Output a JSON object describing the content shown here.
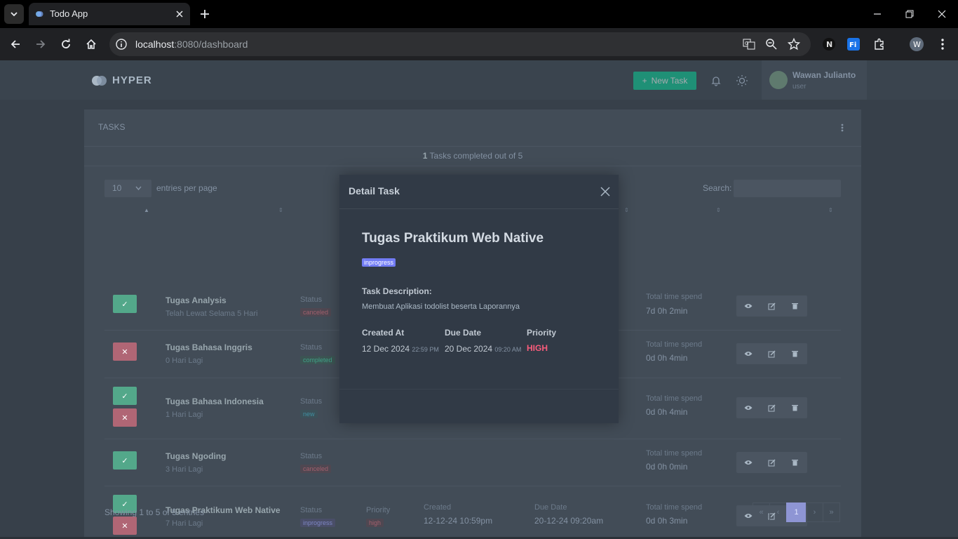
{
  "browser": {
    "tab_title": "Todo App",
    "url_host": "localhost",
    "url_rest": ":8080/dashboard",
    "extensions": [
      "N",
      "Fi",
      "W"
    ]
  },
  "header": {
    "brand": "HYPER",
    "new_task": "New Task",
    "user_name": "Wawan Julianto",
    "user_role": "user"
  },
  "card": {
    "title": "TASKS",
    "completed_count": "1",
    "completed_text": "Tasks completed out of 5",
    "entries_value": "10",
    "entries_label": "entries per page",
    "search_label": "Search:"
  },
  "labels": {
    "status": "Status",
    "priority": "Priority",
    "created": "Created",
    "due_date": "Due Date",
    "total_time": "Total time spend"
  },
  "tasks": [
    {
      "title": "Tugas Analysis",
      "sub": "Telah Lewat Selama 5 Hari",
      "status": "canceled",
      "time": "7d 0h 2min"
    },
    {
      "title": "Tugas Bahasa Inggris",
      "sub": "0 Hari Lagi",
      "status": "completed",
      "time": "0d 0h 4min"
    },
    {
      "title": "Tugas Bahasa Indonesia",
      "sub": "1 Hari Lagi",
      "status": "new",
      "time": "0d 0h 4min"
    },
    {
      "title": "Tugas Ngoding",
      "sub": "3 Hari Lagi",
      "status": "canceled",
      "time": "0d 0h 0min"
    },
    {
      "title": "Tugas Praktikum Web Native",
      "sub": "7 Hari Lagi",
      "status": "inprogress",
      "priority": "high",
      "created": "12-12-24 10:59pm",
      "due": "20-12-24 09:20am",
      "time": "0d 0h 3min"
    }
  ],
  "footer": {
    "showing": "Showing 1 to 5 of 5 entries",
    "pages": [
      "«",
      "‹",
      "1",
      "›",
      "»"
    ]
  },
  "modal": {
    "title": "Detail Task",
    "task_title": "Tugas Praktikum Web Native",
    "status": "inprogress",
    "desc_label": "Task Description:",
    "desc": "Membuat Aplikasi todolist beserta Laporannya",
    "created_label": "Created At",
    "created_date": "12 Dec 2024",
    "created_time": "22:59 PM",
    "due_label": "Due Date",
    "due_date": "20 Dec 2024",
    "due_time": "09:20 AM",
    "priority_label": "Priority",
    "priority": "HIGH"
  },
  "colors": {
    "success": "#0acf97",
    "danger": "#fa5c7c",
    "primary": "#727cf5",
    "modal_bg": "#313a46"
  },
  "icons": [
    "search-icon",
    "chevron-down-icon",
    "close-icon",
    "plus-icon",
    "back-icon",
    "forward-icon",
    "reload-icon",
    "home-icon",
    "info-icon",
    "translate-icon",
    "zoom-icon",
    "star-icon",
    "puzzle-icon",
    "menu-dots-icon",
    "bell-icon",
    "sun-icon",
    "eye-icon",
    "edit-icon",
    "trash-icon",
    "check-icon",
    "x-icon"
  ]
}
